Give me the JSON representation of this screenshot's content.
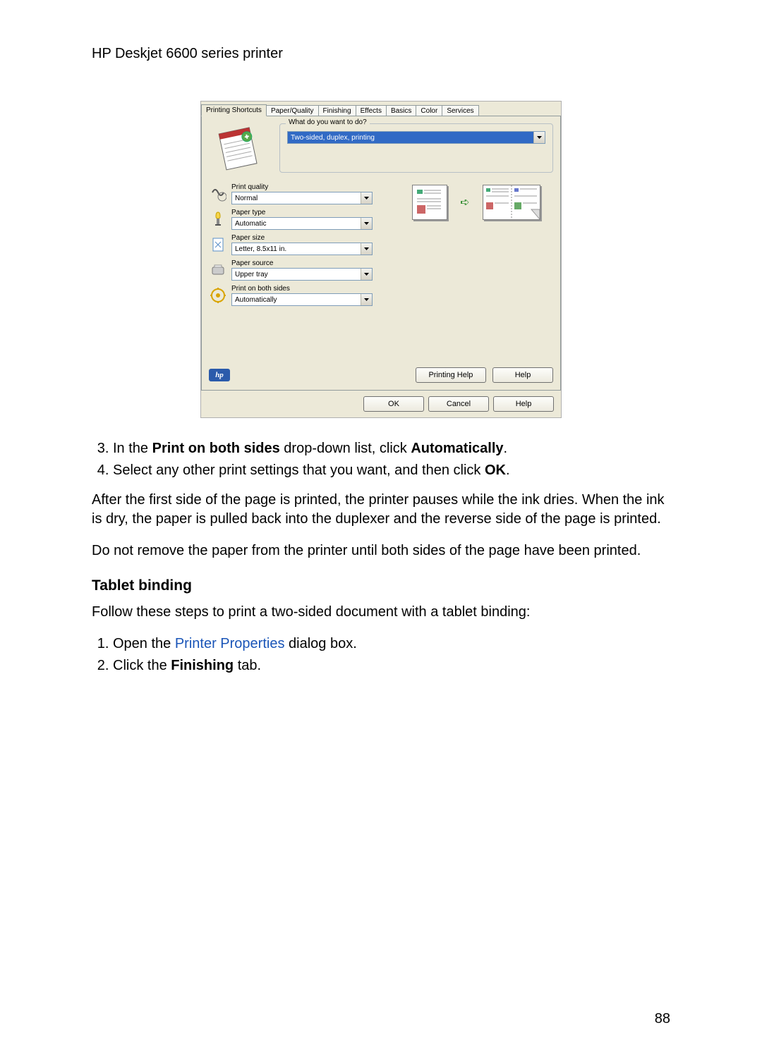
{
  "document": {
    "header": "HP Deskjet 6600 series printer",
    "page_number": "88"
  },
  "dialog": {
    "tabs": [
      "Printing Shortcuts",
      "Paper/Quality",
      "Finishing",
      "Effects",
      "Basics",
      "Color",
      "Services"
    ],
    "active_tab_index": 0,
    "what_do_legend": "What do you want to do?",
    "what_do_value": "Two-sided, duplex, printing",
    "settings": [
      {
        "label": "Print quality",
        "value": "Normal",
        "icon": "print-quality-icon"
      },
      {
        "label": "Paper type",
        "value": "Automatic",
        "icon": "paper-type-icon"
      },
      {
        "label": "Paper size",
        "value": "Letter, 8.5x11 in.",
        "icon": "paper-size-icon"
      },
      {
        "label": "Paper source",
        "value": "Upper tray",
        "icon": "paper-source-icon"
      },
      {
        "label": "Print on both sides",
        "value": "Automatically",
        "icon": "duplex-icon"
      }
    ],
    "buttons": {
      "printing_help": "Printing Help",
      "help": "Help",
      "ok": "OK",
      "cancel": "Cancel",
      "help2": "Help"
    }
  },
  "instructions": {
    "step3_pre": "In the ",
    "step3_bold1": "Print on both sides",
    "step3_mid": " drop-down list, click ",
    "step3_bold2": "Automatically",
    "step3_post": ".",
    "step4_pre": "Select any other print settings that you want, and then click ",
    "step4_bold": "OK",
    "step4_post": ".",
    "para1": "After the first side of the page is printed, the printer pauses while the ink dries. When the ink is dry, the paper is pulled back into the duplexer and the reverse side of the page is printed.",
    "para2": "Do not remove the paper from the printer until both sides of the page have been printed.",
    "heading": "Tablet binding",
    "para3": "Follow these steps to print a two-sided document with a tablet binding:",
    "tb_step1_pre": "Open the ",
    "tb_step1_link": "Printer Properties",
    "tb_step1_post": " dialog box.",
    "tb_step2_pre": "Click the ",
    "tb_step2_bold": "Finishing",
    "tb_step2_post": " tab."
  }
}
